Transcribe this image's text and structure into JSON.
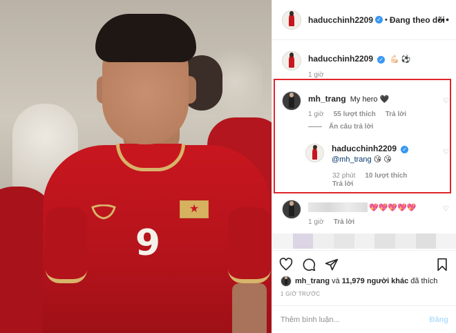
{
  "post": {
    "author": "haducchinh2209",
    "follow_status": "Đang theo dõi",
    "caption_emojis": "💪🏻 ⚽",
    "caption_time": "1 giờ",
    "jersey_number": "9",
    "flag_star": "★"
  },
  "comments": [
    {
      "user": "mh_trang",
      "text": "My hero",
      "emoji": "🖤",
      "time": "1 giờ",
      "likes": "55 lượt thích",
      "reply": "Trả lời",
      "hide_replies": "Ẩn câu trả lời"
    },
    {
      "user": "haducchinh2209",
      "text": "@mh_trang",
      "emoji": "😘 😘",
      "time": "32 phút",
      "likes": "10 lượt thích",
      "reply": "Trả lời"
    },
    {
      "emoji": "💖💖💖💖💖",
      "time": "1 giờ",
      "reply": "Trả lời"
    }
  ],
  "likes_summary": {
    "user": "mh_trang",
    "connector": "và",
    "count_text": "11,979 người khác",
    "suffix": "đã thích"
  },
  "timestamp": "1 GIỜ TRƯỚC",
  "comment_box": {
    "placeholder": "Thêm bình luận...",
    "post_label": "Đăng"
  },
  "icons": [
    "more-icon",
    "heart-icon",
    "comment-icon",
    "share-icon",
    "bookmark-icon",
    "verified-icon"
  ],
  "colors": {
    "accent_blue": "#3897f0",
    "highlight_red": "#e0242c",
    "post_button_disabled": "#b2dffc",
    "jersey_red": "#c8161f"
  }
}
